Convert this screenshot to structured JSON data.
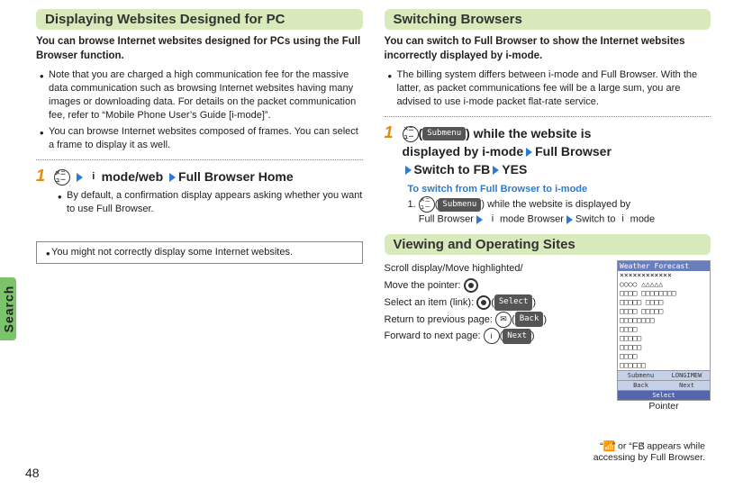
{
  "side_tab": "Search",
  "page_number": "48",
  "left": {
    "section_title": "Displaying Websites Designed for PC",
    "lead": "You can browse Internet websites designed for PCs using the Full Browser function.",
    "bullets": [
      "Note that you are charged a high communication fee for the massive data communication such as browsing Internet websites having many images or downloading data. For details on the packet communication fee, refer to “Mobile Phone User’s Guide [i-mode]”.",
      "You can browse Internet websites composed of frames. You can select a frame to display it as well."
    ],
    "step_num": "1",
    "step_text_prefix_icon_label": "メニュー",
    "step_part2_prefix": " mode/web",
    "step_full_browser": "Full Browser Home",
    "step_note_bullet": "By default, a confirmation display appears asking whether you want to use Full Browser.",
    "note_box_bullet": "You might not correctly display some Internet websites."
  },
  "right": {
    "switch": {
      "title": "Switching Browsers",
      "lead": "You can switch to Full Browser to show the Internet websites incorrectly displayed by i-mode.",
      "bullet": "The billing system differs between i-mode and Full Browser. With the latter, as packet communications fee will be a large sum, you are advised to use i-mode packet flat-rate service.",
      "step_num": "1",
      "step_icon_label": "メニュー",
      "step_pill": "Submenu",
      "step_line1_a": "(",
      "step_line1_b": ") while the website is",
      "step_line2": "displayed by i-mode",
      "step_full_browser": "Full Browser",
      "step_switch": "Switch to FB",
      "step_yes": "YES",
      "sub_head": "To switch from Full Browser to i-mode",
      "sub_1_prefix": "1. ",
      "sub_1_iconlabel": "メニュー",
      "sub_1_pill": "Submenu",
      "sub_1_mid": ") while the website is displayed by",
      "sub_2_a": "Full Browser",
      "sub_2_b": " mode Browser",
      "sub_2_c": "Switch to ",
      "sub_2_d": " mode"
    },
    "view": {
      "title": "Viewing and Operating Sites",
      "l1": "Scroll display/Move highlighted/",
      "l2a": "Move the pointer: ",
      "l3a": "Select an item (link): ",
      "l3_pill": "Select",
      "l4a": "Return to previous page: ",
      "l4_pill": "Back",
      "l5a": "Forward to next page: ",
      "l5_pill": "Next",
      "phone_header": "Weather Forecast",
      "phone_lines": [
        "××××××××××××",
        "○○○○     △△△△△",
        "□□□□ □□□□□□□□",
        "□□□□□ □□□□",
        "□□□□ □□□□□",
        "        □□□□□□□□",
        "        □□□□",
        "        □□□□□",
        "        □□□□□",
        "        □□□□",
        "        □□□□□□"
      ],
      "phone_btn_submenu": "Submenu",
      "phone_btn_long": "LONGIMEW",
      "phone_btn_back": "Back",
      "phone_btn_select": "Select",
      "phone_btn_next": "Next",
      "footer_note_a": "“",
      "footer_note_b": "” or “",
      "footer_note_c": "” appears while",
      "footer_note_d": "accessing by Full Browser.",
      "pointer_label": "Pointer"
    }
  }
}
